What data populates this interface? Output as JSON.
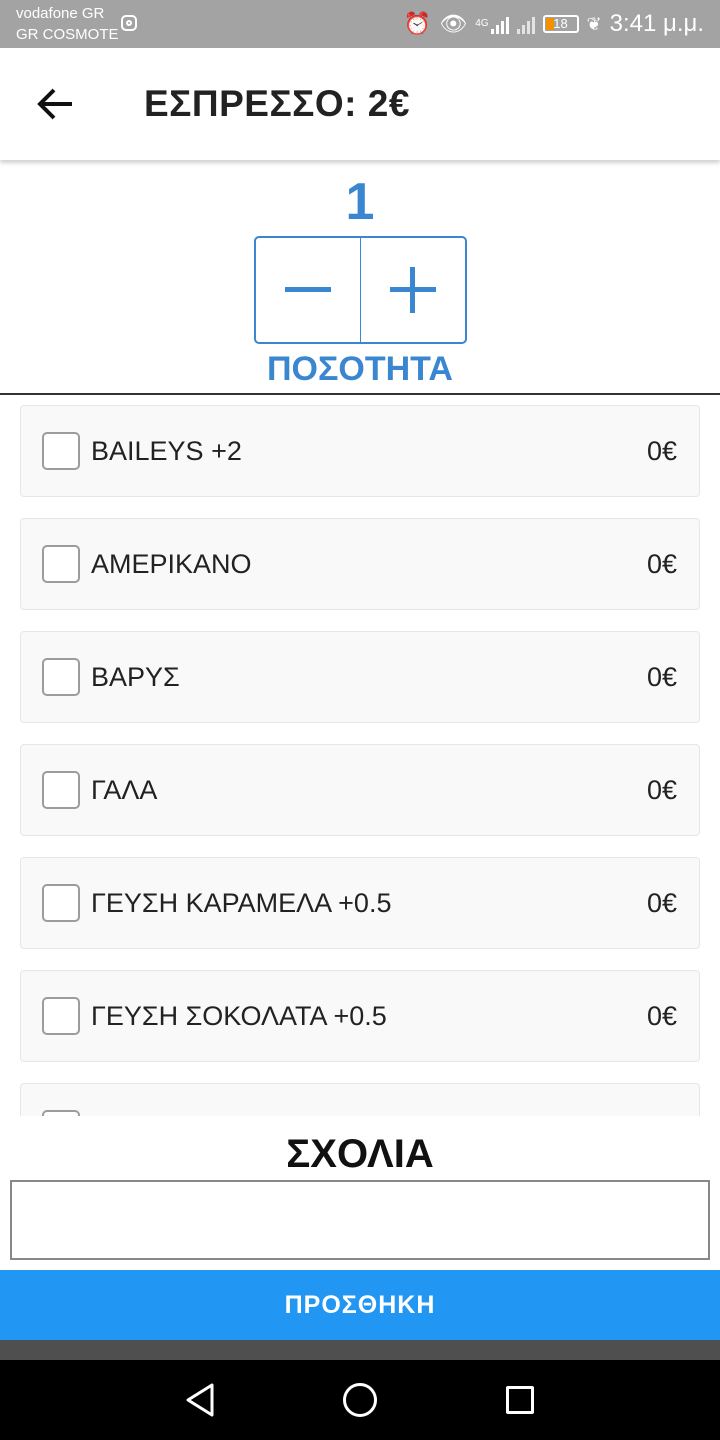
{
  "status_bar": {
    "carrier_1": "vodafone GR",
    "carrier_2": "GR COSMOTE",
    "network": "4G",
    "battery": "18",
    "time": "3:41 μ.μ."
  },
  "header": {
    "title": "ΕΣΠΡΕΣΣΟ: 2€"
  },
  "quantity": {
    "value": "1",
    "minus": "−",
    "plus": "+",
    "label": "ΠΟΣΟΤΗΤΑ"
  },
  "options": [
    {
      "label": "BAILEYS +2",
      "price": "0€",
      "checked": false
    },
    {
      "label": "ΑΜΕΡΙΚΑΝΟ",
      "price": "0€",
      "checked": false
    },
    {
      "label": "ΒΑΡΥΣ",
      "price": "0€",
      "checked": false
    },
    {
      "label": "ΓΑΛΑ",
      "price": "0€",
      "checked": false
    },
    {
      "label": "ΓΕΥΣΗ ΚΑΡΑΜΕΛΑ +0.5",
      "price": "0€",
      "checked": false
    },
    {
      "label": "ΓΕΥΣΗ ΣΟΚΟΛΑΤΑ +0.5",
      "price": "0€",
      "checked": false
    }
  ],
  "comments": {
    "label": "ΣΧΟΛΙΑ",
    "value": ""
  },
  "add_button": {
    "label": "ΠΡΟΣΘΗΚΗ"
  },
  "colors": {
    "accent": "#3a86d1",
    "button": "#2196f3",
    "battery_low": "#f39200"
  }
}
